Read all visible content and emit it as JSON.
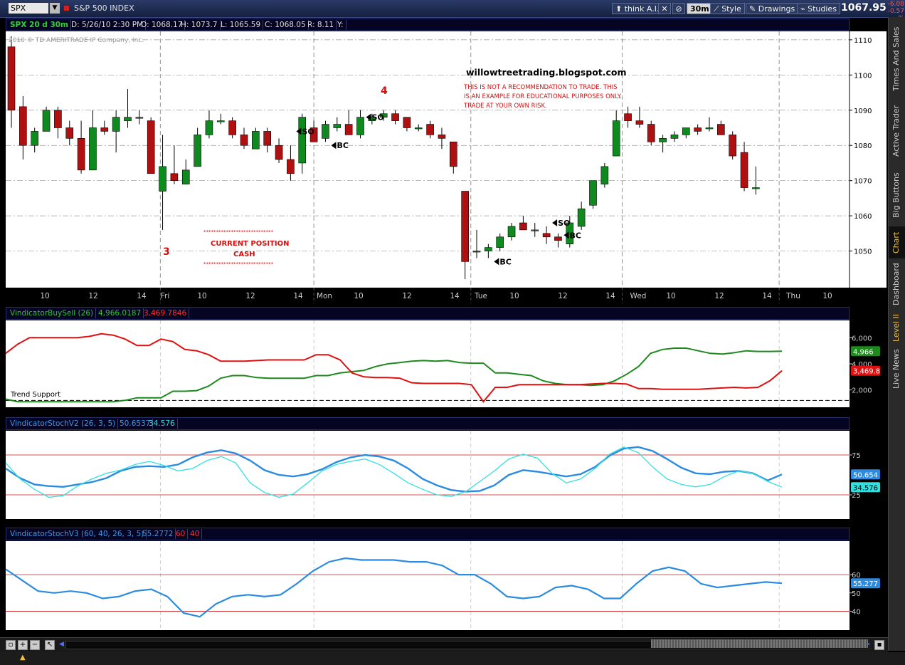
{
  "toolbar": {
    "symbol": "SPX",
    "symbol_desc": "S&P 500 INDEX",
    "think_label": "think A.I.",
    "period": "30m",
    "style_label": "Style",
    "drawings_label": "Drawings",
    "studies_label": "Studies",
    "last_price": "1067.95",
    "change": "-6.08",
    "change_pct": "-0.57 %"
  },
  "info": {
    "chart_name": "SPX 20 d 30m",
    "date": "D: 5/26/10 2:30 PM",
    "open": "O: 1068.17",
    "high": "H: 1073.7",
    "low": "L: 1065.59",
    "close": "C: 1068.05",
    "range": "R: 8.11",
    "y": "Y:"
  },
  "sidebar": {
    "tabs": [
      "Times And Sales",
      "Active Trader",
      "Big Buttons",
      "Chart",
      "Dashboard",
      "Level II",
      "Live News"
    ]
  },
  "chart_data": [
    {
      "type": "candlestick",
      "copyright": "2010 © TD AMERITRADE IP Company, Inc.",
      "ylim": [
        1040,
        1112
      ],
      "yticks": [
        1050,
        1060,
        1070,
        1080,
        1090,
        1100,
        1110
      ],
      "x_labels": [
        "10",
        "12",
        "14",
        "Fri",
        "10",
        "12",
        "14",
        "Mon",
        "10",
        "12",
        "14",
        "Tue",
        "10",
        "12",
        "14",
        "Wed",
        "10",
        "12",
        "14",
        "Thu",
        "10"
      ],
      "candles": [
        [
          1108,
          1111,
          1085,
          1090
        ],
        [
          1091,
          1094,
          1076,
          1080
        ],
        [
          1080,
          1085,
          1078,
          1084
        ],
        [
          1084,
          1091,
          1084,
          1090
        ],
        [
          1090,
          1091,
          1082,
          1085
        ],
        [
          1085,
          1087,
          1080,
          1082
        ],
        [
          1082,
          1087,
          1072,
          1073
        ],
        [
          1073,
          1090,
          1073,
          1085
        ],
        [
          1085,
          1087,
          1083,
          1084
        ],
        [
          1084,
          1090,
          1078,
          1088
        ],
        [
          1087,
          1096,
          1085,
          1088
        ],
        [
          1088,
          1090,
          1086,
          1088
        ],
        [
          1087,
          1088,
          1072,
          1072
        ],
        [
          1067,
          1083,
          1056,
          1074
        ],
        [
          1072,
          1080,
          1069,
          1070
        ],
        [
          1069,
          1076,
          1069,
          1073
        ],
        [
          1074,
          1085,
          1074,
          1083
        ],
        [
          1083,
          1090,
          1082,
          1087
        ],
        [
          1087,
          1089,
          1086,
          1087
        ],
        [
          1087,
          1088,
          1082,
          1083
        ],
        [
          1083,
          1085,
          1079,
          1080
        ],
        [
          1079,
          1085,
          1079,
          1084
        ],
        [
          1084,
          1085,
          1078,
          1080
        ],
        [
          1080,
          1082,
          1075,
          1076
        ],
        [
          1076,
          1080,
          1070,
          1072
        ],
        [
          1075,
          1089,
          1072,
          1088
        ],
        [
          1085,
          1087,
          1081,
          1081
        ],
        [
          1082,
          1087,
          1081,
          1086
        ],
        [
          1085,
          1088,
          1084,
          1086
        ],
        [
          1086,
          1090,
          1084,
          1083
        ],
        [
          1083,
          1090,
          1082,
          1088
        ],
        [
          1087,
          1089,
          1086,
          1088
        ],
        [
          1088,
          1090,
          1087,
          1089
        ],
        [
          1089,
          1090,
          1086,
          1087
        ],
        [
          1088,
          1088,
          1084,
          1085
        ],
        [
          1085,
          1086,
          1084,
          1085
        ],
        [
          1086,
          1087,
          1082,
          1083
        ],
        [
          1083,
          1085,
          1079,
          1082
        ],
        [
          1081,
          1081,
          1072,
          1074
        ],
        [
          1067,
          1067,
          1042,
          1047
        ],
        [
          1050,
          1056,
          1048,
          1050
        ],
        [
          1050,
          1052,
          1048,
          1051
        ],
        [
          1051,
          1055,
          1050,
          1054
        ],
        [
          1054,
          1058,
          1053,
          1057
        ],
        [
          1058,
          1060,
          1056,
          1056
        ],
        [
          1056,
          1058,
          1054,
          1056
        ],
        [
          1055,
          1057,
          1052,
          1054
        ],
        [
          1054,
          1055,
          1051,
          1053
        ],
        [
          1052,
          1060,
          1051,
          1058
        ],
        [
          1057,
          1064,
          1056,
          1062
        ],
        [
          1063,
          1070,
          1062,
          1070
        ],
        [
          1069,
          1075,
          1068,
          1074
        ],
        [
          1077,
          1090,
          1077,
          1087
        ],
        [
          1089,
          1091,
          1085,
          1087
        ],
        [
          1087,
          1091,
          1085,
          1086
        ],
        [
          1086,
          1087,
          1080,
          1081
        ],
        [
          1081,
          1083,
          1078,
          1082
        ],
        [
          1082,
          1084,
          1081,
          1083
        ],
        [
          1083,
          1085,
          1082,
          1085
        ],
        [
          1085,
          1086,
          1083,
          1084
        ],
        [
          1085,
          1088,
          1084,
          1085
        ],
        [
          1086,
          1087,
          1083,
          1083
        ],
        [
          1083,
          1084,
          1076,
          1077
        ],
        [
          1078,
          1081,
          1067,
          1068
        ],
        [
          1068,
          1074,
          1066,
          1068
        ]
      ],
      "annotations": [
        {
          "text": "willowtreetrading.blogspot.com"
        },
        {
          "text": "THIS IS NOT A RECOMMENDATION TO TRADE.  THIS"
        },
        {
          "text": "IS AN EXAMPLE FOR EDUCATIONAL PURPOSES ONLY."
        },
        {
          "text": "TRADE AT YOUR OWN RISK."
        },
        {
          "text": "3"
        },
        {
          "text": "4"
        },
        {
          "text": "CURRENT POSITION"
        },
        {
          "text": "CASH"
        },
        {
          "text": "****************************"
        }
      ],
      "signals": [
        {
          "label": "SO",
          "candle": 24,
          "price": 1084
        },
        {
          "label": "BC",
          "candle": 27,
          "price": 1080
        },
        {
          "label": "SO",
          "candle": 30,
          "price": 1088
        },
        {
          "label": "SO",
          "candle": 46,
          "price": 1058
        },
        {
          "label": "BC",
          "candle": 47,
          "price": 1054.5
        },
        {
          "label": "BC",
          "candle": 41,
          "price": 1047
        }
      ]
    },
    {
      "type": "line",
      "title": "VindicatorBuySell (26)",
      "ylim": [
        1000,
        7000
      ],
      "yticks": [
        2000,
        4000,
        6000
      ],
      "ytick_labels": [
        "2,000",
        "4,000",
        "6,000"
      ],
      "trend_support_label": "Trend Support",
      "trend_support_value": 1200,
      "series": [
        {
          "name": "4,966.0187",
          "color": "#1e8a1e",
          "last_label": "4,966",
          "values": [
            1300,
            1100,
            1100,
            1100,
            1100,
            1100,
            1100,
            1100,
            1100,
            1100,
            1200,
            1400,
            1400,
            1400,
            1900,
            1900,
            1950,
            2300,
            2900,
            3100,
            3100,
            2950,
            2900,
            2900,
            2900,
            2900,
            3100,
            3100,
            3300,
            3400,
            3500,
            3800,
            4000,
            4100,
            4200,
            4250,
            4200,
            4250,
            4100,
            4050,
            4050,
            3300,
            3300,
            3200,
            3100,
            2700,
            2500,
            2400,
            2400,
            2350,
            2400,
            2700,
            3200,
            3800,
            4800,
            5100,
            5200,
            5200,
            5000,
            4800,
            4750,
            4850,
            5000,
            4950,
            4950,
            4966
          ]
        },
        {
          "name": "3,469.7846",
          "color": "#e01010",
          "last_label": "3,469.8",
          "values": [
            4800,
            5500,
            6000,
            6000,
            6000,
            6000,
            6000,
            6100,
            6300,
            6200,
            5900,
            5400,
            5400,
            5900,
            5700,
            5100,
            5000,
            4700,
            4200,
            4200,
            4200,
            4250,
            4300,
            4300,
            4300,
            4300,
            4700,
            4700,
            4300,
            3300,
            3000,
            2950,
            2950,
            2900,
            2550,
            2500,
            2500,
            2500,
            2500,
            2400,
            1100,
            2200,
            2200,
            2400,
            2400,
            2400,
            2400,
            2400,
            2400,
            2450,
            2500,
            2500,
            2450,
            2100,
            2100,
            2050,
            2050,
            2050,
            2050,
            2100,
            2150,
            2200,
            2150,
            2200,
            2700,
            3470
          ]
        }
      ]
    },
    {
      "type": "line",
      "title": "VindicatorStochV2 (26, 3, 5)",
      "ylim": [
        0,
        100
      ],
      "yticks": [
        25,
        75
      ],
      "series": [
        {
          "name": "50.6537",
          "color": "#2a8be0",
          "last_label": "50.654",
          "values": [
            58,
            46,
            38,
            36,
            35,
            38,
            41,
            46,
            55,
            60,
            61,
            60,
            63,
            72,
            78,
            81,
            77,
            68,
            56,
            50,
            48,
            51,
            57,
            66,
            72,
            75,
            73,
            68,
            58,
            45,
            37,
            31,
            29,
            30,
            37,
            50,
            56,
            54,
            51,
            48,
            51,
            60,
            74,
            83,
            85,
            80,
            70,
            59,
            52,
            51,
            54,
            55,
            52,
            43,
            50.65
          ]
        },
        {
          "name": "34.576",
          "color": "#33e0e0",
          "last_label": "34.576",
          "values": [
            65,
            45,
            32,
            22,
            24,
            36,
            45,
            52,
            56,
            63,
            67,
            62,
            55,
            58,
            68,
            73,
            65,
            40,
            28,
            22,
            26,
            40,
            55,
            63,
            67,
            70,
            63,
            52,
            40,
            32,
            25,
            23,
            29,
            42,
            55,
            70,
            76,
            71,
            52,
            40,
            45,
            58,
            76,
            85,
            78,
            60,
            45,
            38,
            35,
            38,
            48,
            55,
            52,
            42,
            34.58
          ]
        }
      ]
    },
    {
      "type": "line",
      "title": "VindicatorStochV3 (60, 40, 26, 3, 5)",
      "ylim": [
        32,
        76
      ],
      "yticks": [
        40,
        50,
        60
      ],
      "ref_labels": [
        "60",
        "40"
      ],
      "ref_values": [
        60,
        40
      ],
      "series": [
        {
          "name": "55.2772",
          "color": "#2a8be0",
          "last_label": "55.277",
          "values": [
            63,
            57,
            51,
            50,
            51,
            50,
            47,
            48,
            51,
            52,
            48,
            39,
            37,
            44,
            48,
            49,
            48,
            49,
            55,
            62,
            67,
            69,
            68,
            68,
            68,
            67,
            67,
            65,
            60,
            60,
            55,
            48,
            47,
            48,
            53,
            54,
            52,
            47,
            47,
            55,
            62,
            64,
            62,
            55,
            53,
            54,
            55,
            56,
            55.28
          ]
        }
      ]
    }
  ]
}
